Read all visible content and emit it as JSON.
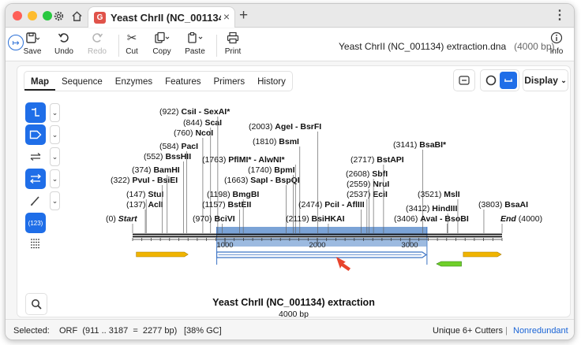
{
  "window": {
    "tab_title": "Yeast ChrII (NC_001134) extr",
    "close_glyph": "×",
    "new_tab_glyph": "+",
    "menu_glyph": "⋮"
  },
  "toolbar": {
    "save_label": "Save",
    "undo_label": "Undo",
    "redo_label": "Redo",
    "cut_label": "Cut",
    "copy_label": "Copy",
    "paste_label": "Paste",
    "print_label": "Print",
    "info_label": "Info",
    "doc_name": "Yeast ChrII (NC_001134) extraction.dna",
    "doc_length": "(4000 bp)"
  },
  "view_tabs": [
    "Map",
    "Sequence",
    "Enzymes",
    "Features",
    "Primers",
    "History"
  ],
  "active_view_tab": "Map",
  "display_label": "Display",
  "map": {
    "title": "Yeast ChrII (NC_001134) extraction",
    "subtitle": "4000 bp",
    "start_label": "Start",
    "end_label": "End",
    "end_pos": "(4000)",
    "start_pos": "(0)",
    "ruler_ticks": [
      "1000",
      "2000",
      "3000"
    ],
    "selection": {
      "start": 911,
      "end": 3187
    },
    "sites": [
      {
        "pos": "(0)",
        "name": "Start"
      },
      {
        "pos": "(137)",
        "name": "AclI"
      },
      {
        "pos": "(147)",
        "name": "StuI"
      },
      {
        "pos": "(322)",
        "name": "PvuI - BsiEI"
      },
      {
        "pos": "(374)",
        "name": "BamHI"
      },
      {
        "pos": "(552)",
        "name": "BssHII"
      },
      {
        "pos": "(584)",
        "name": "PacI"
      },
      {
        "pos": "(760)",
        "name": "NcoI"
      },
      {
        "pos": "(844)",
        "name": "ScaI"
      },
      {
        "pos": "(922)",
        "name": "CsiI - SexAI*"
      },
      {
        "pos": "(970)",
        "name": "BciVI"
      },
      {
        "pos": "(1157)",
        "name": "BstEII"
      },
      {
        "pos": "(1198)",
        "name": "BmgBI"
      },
      {
        "pos": "(1663)",
        "name": "SapI - BspQI"
      },
      {
        "pos": "(1740)",
        "name": "BpmI"
      },
      {
        "pos": "(1763)",
        "name": "PflMI* - AlwNI*"
      },
      {
        "pos": "(1810)",
        "name": "BsmI"
      },
      {
        "pos": "(2003)",
        "name": "AgeI - BsrFI"
      },
      {
        "pos": "(2119)",
        "name": "BsiHKAI"
      },
      {
        "pos": "(2474)",
        "name": "PciI - AflIII"
      },
      {
        "pos": "(2537)",
        "name": "EciI"
      },
      {
        "pos": "(2559)",
        "name": "NruI"
      },
      {
        "pos": "(2608)",
        "name": "SbfI"
      },
      {
        "pos": "(2717)",
        "name": "BstAPI"
      },
      {
        "pos": "(3141)",
        "name": "BsaBI*"
      },
      {
        "pos": "(3406)",
        "name": "AvaI - BsoBI"
      },
      {
        "pos": "(3412)",
        "name": "HindIII"
      },
      {
        "pos": "(3521)",
        "name": "MslI"
      },
      {
        "pos": "(3803)",
        "name": "BsaAI"
      },
      {
        "pos": "(4000)",
        "name": "End"
      }
    ],
    "colors": {
      "selection": "#7ba3d6",
      "orf_outline": "#3b73c4",
      "feature_yellow": "#f0b400",
      "feature_green": "#6fcf2a",
      "pointer": "#e8442c"
    }
  },
  "status": {
    "selected_label": "Selected:",
    "selection_text": "ORF  (911 .. 3187  =  2277 bp)",
    "gc_text": "[38% GC]",
    "cutters": "Unique 6+ Cutters",
    "divider": "|",
    "nonredundant": "Nonredundant"
  }
}
